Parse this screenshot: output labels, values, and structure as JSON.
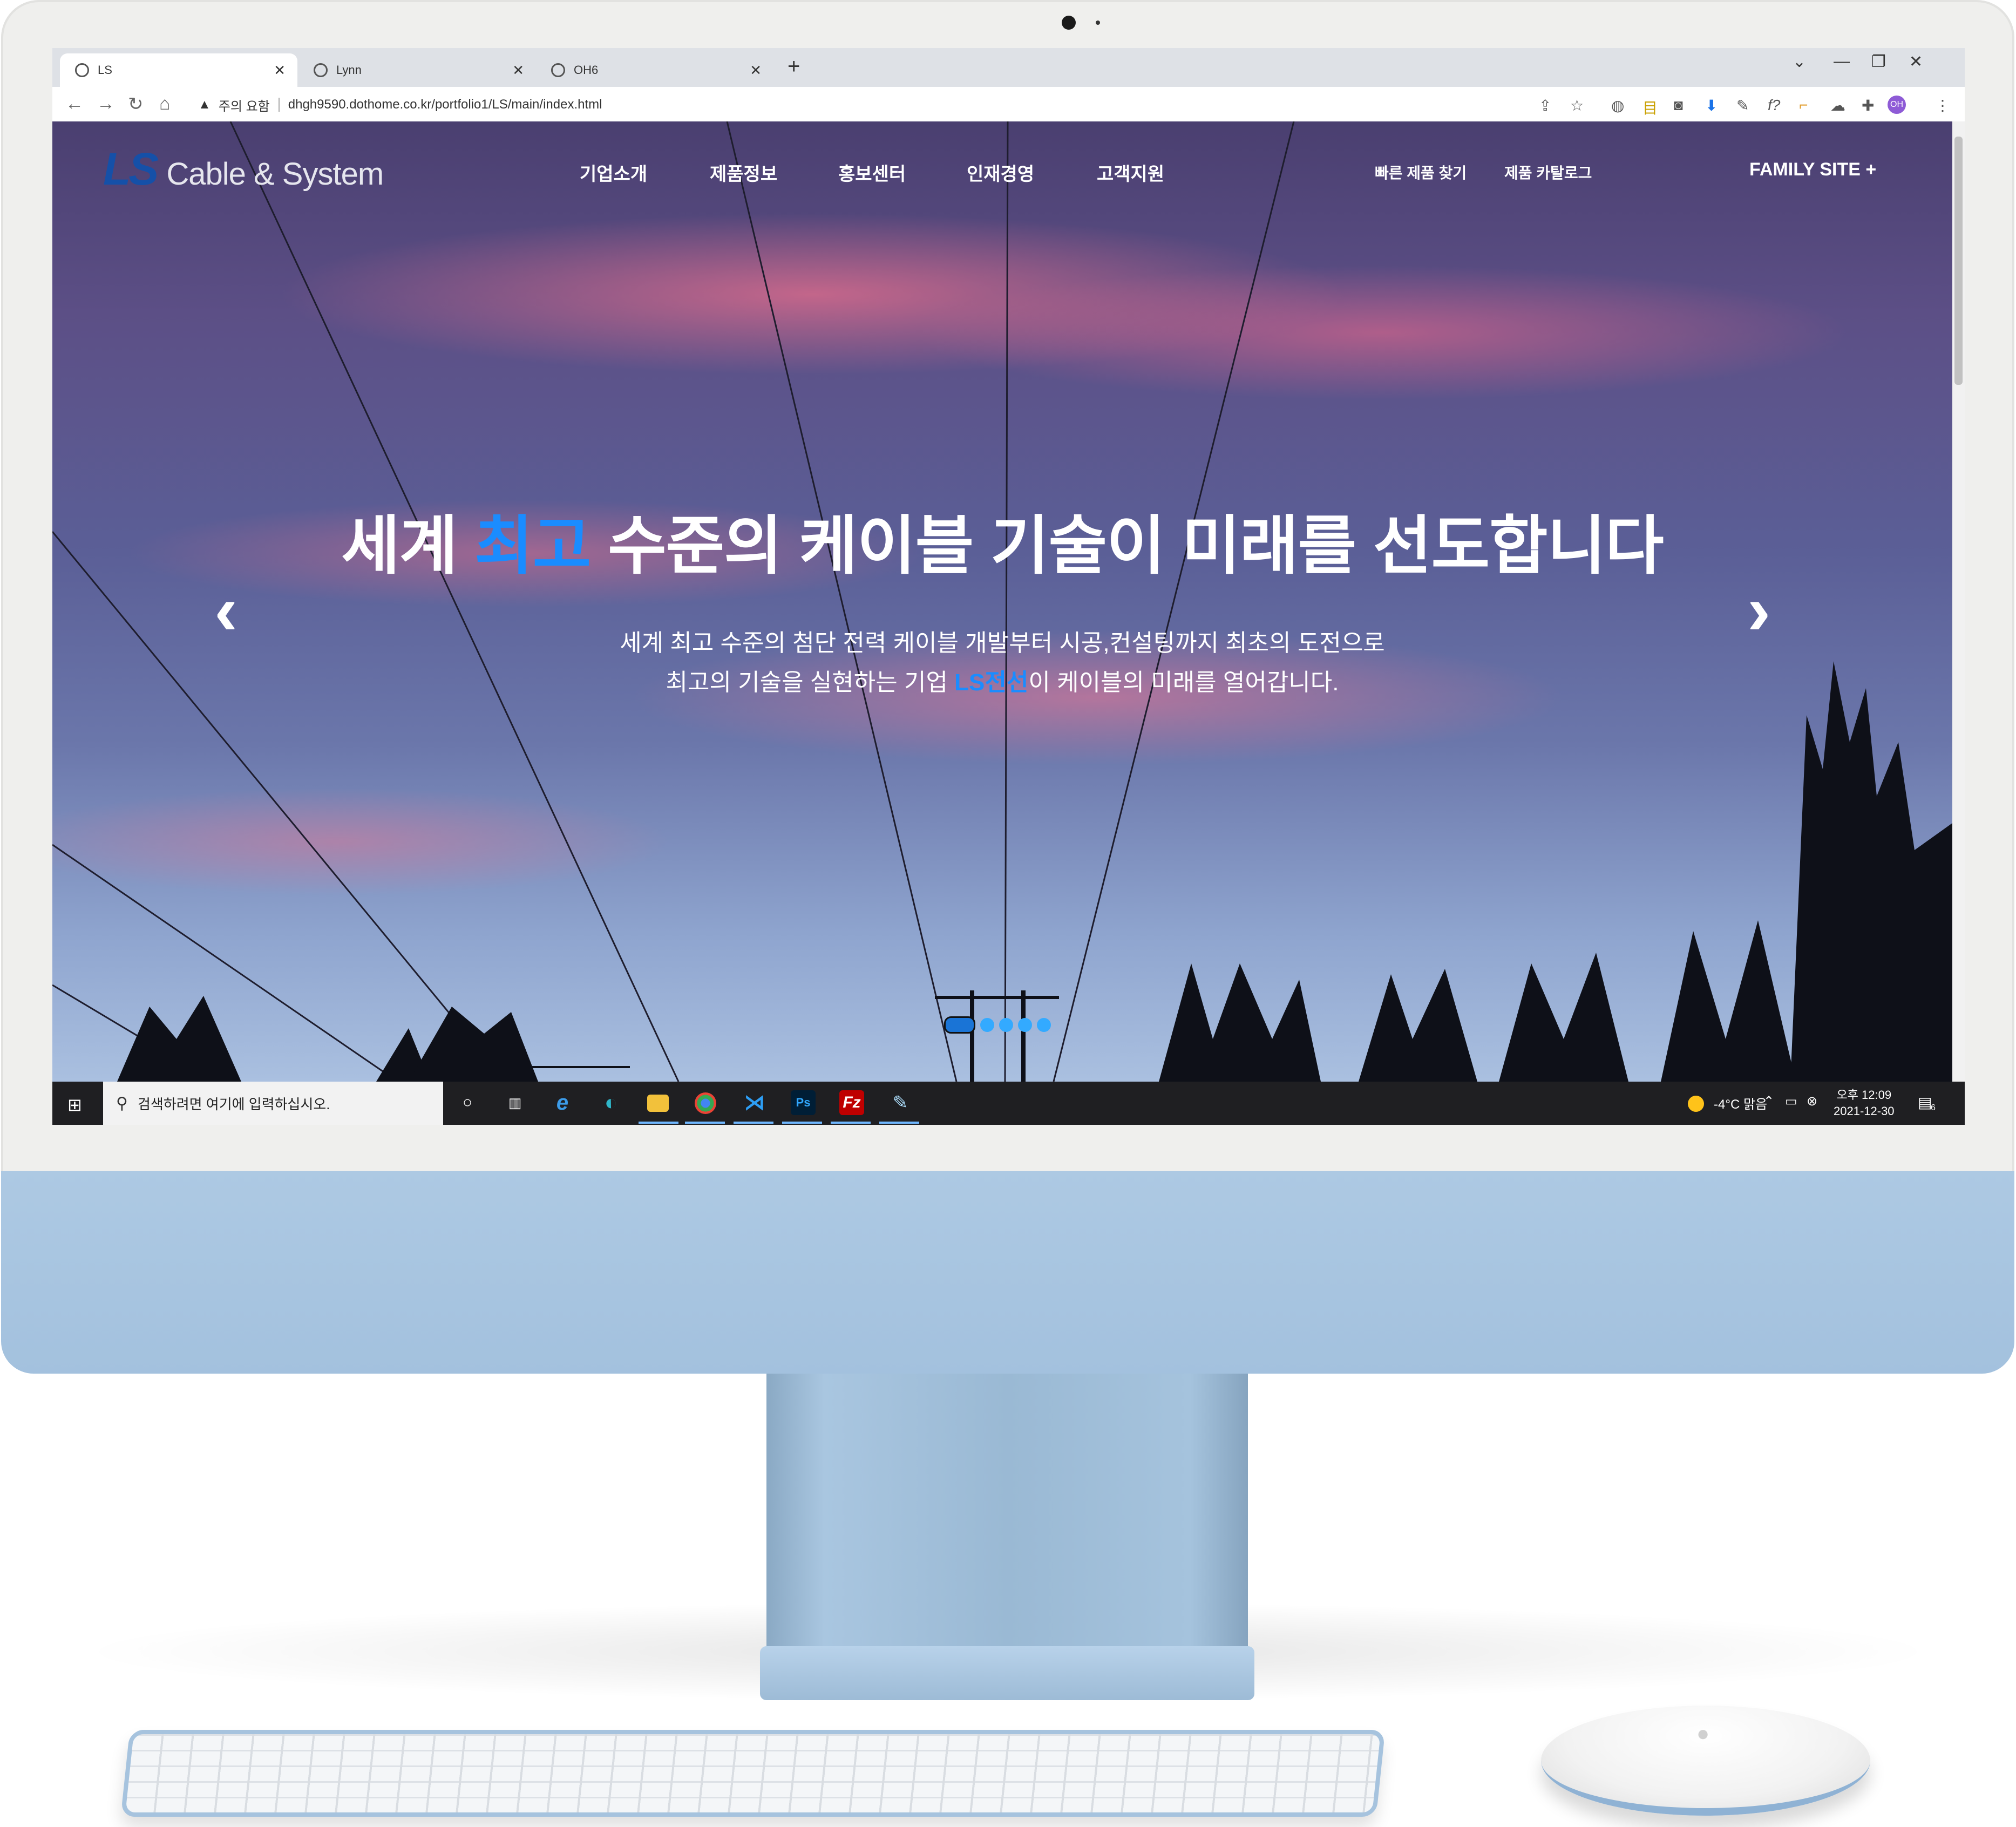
{
  "browser": {
    "tabs": [
      {
        "title": "LS",
        "active": true
      },
      {
        "title": "Lynn",
        "active": false
      },
      {
        "title": "OH6",
        "active": false
      }
    ],
    "new_tab": "+",
    "security_label": "주의 요함",
    "url": "dhgh9590.dothome.co.kr/portfolio1/LS/main/index.html",
    "profile_initials": "OH"
  },
  "site": {
    "logo_mark": "LS",
    "logo_text": "Cable & System",
    "nav": [
      "기업소개",
      "제품정보",
      "홍보센터",
      "인재경영",
      "고객지원"
    ],
    "utility": [
      "빠른 제품 찾기",
      "제품 카탈로그"
    ],
    "family_site": "FAMILY SITE +"
  },
  "hero": {
    "headline_pre": "세계 ",
    "headline_highlight": "최고",
    "headline_post": " 수준의 케이블 기술이 미래를 선도합니다",
    "sub_line1": "세계 최고 수준의 첨단 전력 케이블 개발부터 시공,컨설팅까지 최초의 도전으로",
    "sub_line2_pre": "최고의 기술을 실현하는 기업 ",
    "sub_line2_highlight": "LS전선",
    "sub_line2_post": "이 케이블의 미래를 열어갑니다.",
    "slide_count": 5,
    "active_slide": 1,
    "prev_icon": "‹",
    "next_icon": "›"
  },
  "taskbar": {
    "search_placeholder": "검색하려면 여기에 입력하십시오.",
    "weather": "-4°C 맑음",
    "time": "오후 12:09",
    "date": "2021-12-30",
    "notification_count": "6",
    "apps": [
      "task-view",
      "internet-explorer",
      "edge",
      "file-explorer",
      "chrome",
      "vscode",
      "photoshop",
      "filezilla",
      "paint"
    ]
  },
  "colors": {
    "accent": "#1a8cff",
    "logo_blue": "#1550a8",
    "taskbar": "#1f1f22"
  }
}
